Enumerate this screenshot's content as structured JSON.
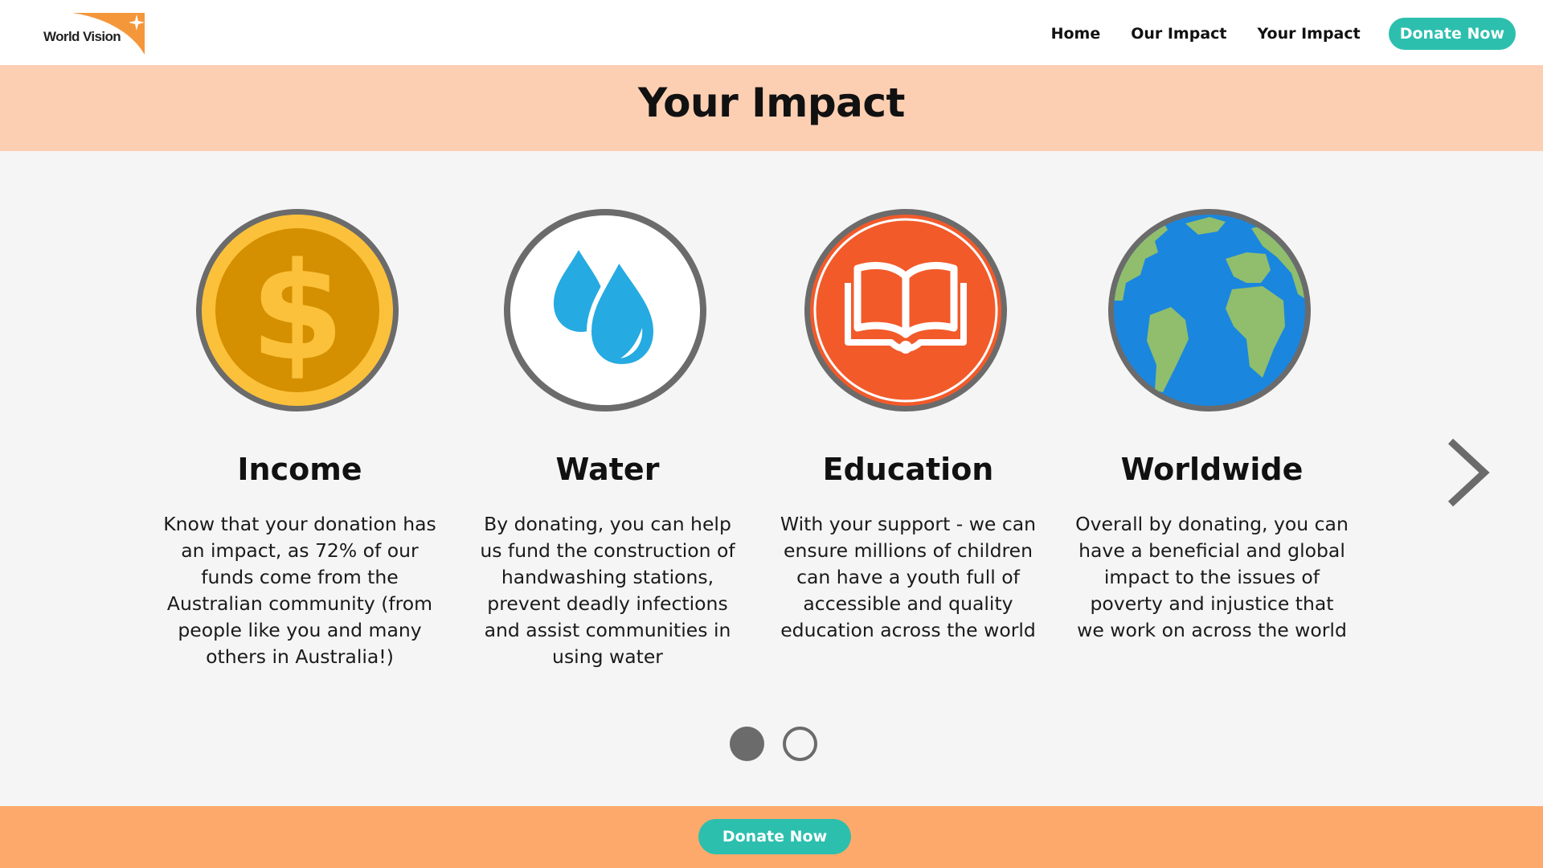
{
  "brand": {
    "name": "World Vision",
    "accent": "#f4973b"
  },
  "nav": {
    "items": [
      "Home",
      "Our Impact",
      "Your Impact"
    ],
    "donate_label": "Donate Now"
  },
  "page": {
    "title": "Your Impact"
  },
  "cards": [
    {
      "title": "Income",
      "icon": "dollar-coin-icon",
      "text": "Know that your donation has an impact, as 72% of our funds come from the Australian community (from people like you and many others in Australia!)"
    },
    {
      "title": "Water",
      "icon": "water-drop-icon",
      "text": "By donating, you can help us fund the construction of handwashing stations, prevent deadly infections and assist communities in using water"
    },
    {
      "title": "Education",
      "icon": "open-book-icon",
      "text": "With your support - we can ensure millions of children can have a youth full of accessible and quality education across the world"
    },
    {
      "title": "Worldwide",
      "icon": "globe-icon",
      "text": "Overall by donating, you can have a beneficial and global impact to the issues of poverty and injustice that we work on across the world"
    }
  ],
  "carousel": {
    "current_page": 1,
    "total_pages": 2,
    "next_icon": "chevron-right-icon"
  },
  "footer": {
    "donate_label": "Donate Now"
  },
  "colors": {
    "teal": "#2cbfae",
    "title_band": "#fccfb2",
    "footer": "#fea96c",
    "main_bg": "#f5f5f5",
    "ring_gray": "#6b6b6b"
  }
}
